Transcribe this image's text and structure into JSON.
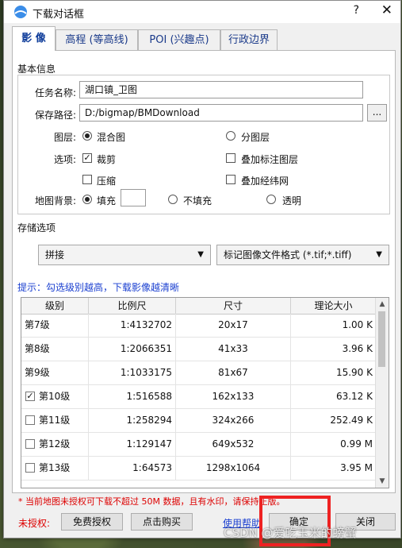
{
  "window": {
    "title": "下载对话框",
    "help": "?",
    "close": "✕"
  },
  "tabs": [
    {
      "label": "影 像",
      "active": true
    },
    {
      "label": "高程 (等高线)",
      "active": false
    },
    {
      "label": "POI (兴趣点)",
      "active": false
    },
    {
      "label": "行政边界",
      "active": false
    }
  ],
  "basic": {
    "section_title": "基本信息",
    "task_name_label": "任务名称:",
    "task_name_value": "湖口镇_卫图",
    "save_path_label": "保存路径:",
    "save_path_value": "D:/bigmap/BMDownload",
    "browse_label": "...",
    "layer_label": "图层:",
    "layer_mixed": "混合图",
    "layer_split": "分图层",
    "options_label": "选项:",
    "opt_crop": "裁剪",
    "opt_overlay_labels": "叠加标注图层",
    "opt_compress": "压缩",
    "opt_overlay_grid": "叠加经纬网",
    "bg_label": "地图背景:",
    "bg_fill": "填充",
    "bg_nofill": "不填充",
    "bg_transparent": "透明"
  },
  "storage": {
    "section_title": "存储选项",
    "mode": "拼接",
    "format": "标记图像文件格式 (*.tif;*.tiff)"
  },
  "hint": "提示：勾选级别越高，下载影像越清晰",
  "table": {
    "headers": [
      "级别",
      "比例尺",
      "尺寸",
      "理论大小"
    ],
    "rows": [
      {
        "level": "第7级",
        "scale": "1:4132702",
        "size": "20x17",
        "est": "1.00 K",
        "checkbox": false,
        "checked": false
      },
      {
        "level": "第8级",
        "scale": "1:2066351",
        "size": "41x33",
        "est": "3.96 K",
        "checkbox": false,
        "checked": false
      },
      {
        "level": "第9级",
        "scale": "1:1033175",
        "size": "81x67",
        "est": "15.90 K",
        "checkbox": false,
        "checked": false
      },
      {
        "level": "第10级",
        "scale": "1:516588",
        "size": "162x133",
        "est": "63.12 K",
        "checkbox": true,
        "checked": true
      },
      {
        "level": "第11级",
        "scale": "1:258294",
        "size": "324x266",
        "est": "252.49 K",
        "checkbox": true,
        "checked": false
      },
      {
        "level": "第12级",
        "scale": "1:129147",
        "size": "649x532",
        "est": "0.99 M",
        "checkbox": true,
        "checked": false
      },
      {
        "level": "第13级",
        "scale": "1:64573",
        "size": "1298x1064",
        "est": "3.95 M",
        "checkbox": true,
        "checked": false
      }
    ]
  },
  "warning": "* 当前地图未授权可下载不超过 50M 数据，且有水印，请保持正版。",
  "footer": {
    "unauth_label": "未授权:",
    "free_auth": "免费授权",
    "buy": "点击购买",
    "help_link": "使用帮助",
    "ok": "确定",
    "close": "关闭"
  },
  "watermark": "CSDN @爱吃玉米的螃蟹",
  "colors": {
    "accent": "#1a3fd0",
    "warning": "#dd0000",
    "highlight": "#ee2222"
  }
}
